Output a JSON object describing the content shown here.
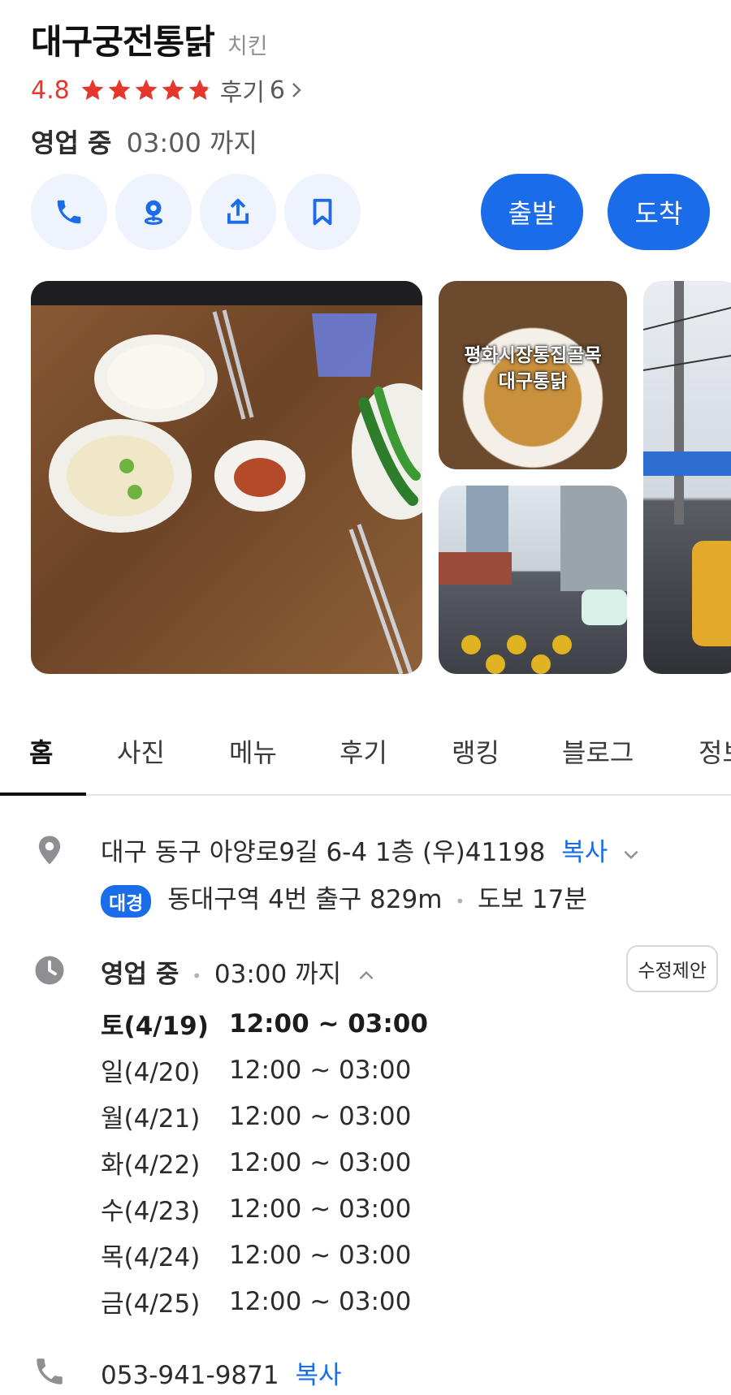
{
  "store": {
    "name": "대구궁전통닭",
    "category": "치킨",
    "rating": "4.8",
    "stars": 4.8,
    "review_label": "후기",
    "review_count": "6",
    "status_open": "영업 중",
    "status_time": "03:00 까지"
  },
  "actions": {
    "icons": [
      "phone-icon",
      "street-view-icon",
      "share-icon",
      "bookmark-icon"
    ],
    "depart_label": "출발",
    "arrive_label": "도착"
  },
  "photos": {
    "caption": "평화시장통집골목\n대구통닭"
  },
  "tabs": [
    "홈",
    "사진",
    "메뉴",
    "후기",
    "랭킹",
    "블로그",
    "정보"
  ],
  "address": {
    "text": "대구 동구 아양로9길 6-4 1층 (우)41198",
    "copy_label": "복사",
    "transit_badge": "대경",
    "transit_text": "동대구역 4번 출구 829m",
    "walk_text": "도보 17분"
  },
  "hours": {
    "status_open": "영업 중",
    "status_time": "03:00 까지",
    "suggest_label": "수정제안",
    "days": [
      {
        "day": "토(4/19)",
        "time": "12:00 ~ 03:00",
        "today": true
      },
      {
        "day": "일(4/20)",
        "time": "12:00 ~ 03:00",
        "today": false
      },
      {
        "day": "월(4/21)",
        "time": "12:00 ~ 03:00",
        "today": false
      },
      {
        "day": "화(4/22)",
        "time": "12:00 ~ 03:00",
        "today": false
      },
      {
        "day": "수(4/23)",
        "time": "12:00 ~ 03:00",
        "today": false
      },
      {
        "day": "목(4/24)",
        "time": "12:00 ~ 03:00",
        "today": false
      },
      {
        "day": "금(4/25)",
        "time": "12:00 ~ 03:00",
        "today": false
      }
    ]
  },
  "phone": {
    "number": "053-941-9871",
    "copy_label": "복사"
  },
  "colors": {
    "accent": "#1a6ce8",
    "rating": "#e5372b",
    "icon_bg": "#eef3fd"
  }
}
